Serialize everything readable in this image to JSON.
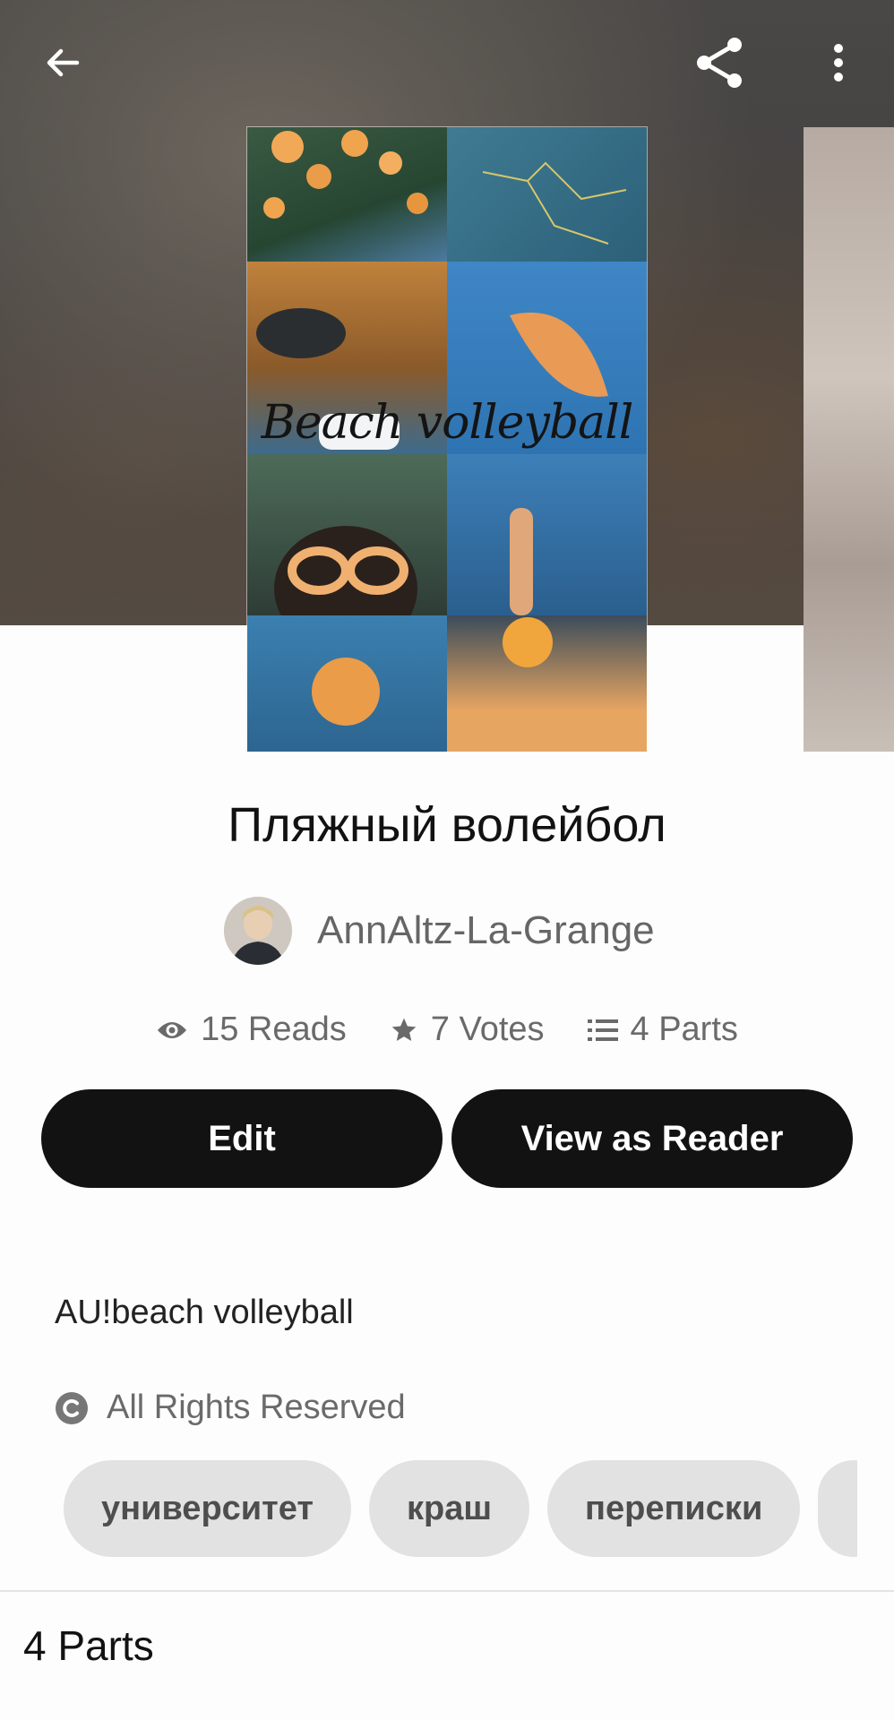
{
  "cover": {
    "overlay_text": "Beach volleyball"
  },
  "story": {
    "title": "Пляжный волейбол",
    "author": "AnnAltz-La-Grange"
  },
  "stats": {
    "reads": "15 Reads",
    "votes": "7 Votes",
    "parts": "4 Parts"
  },
  "actions": {
    "edit_label": "Edit",
    "view_as_reader_label": "View as Reader"
  },
  "description": "AU!beach volleyball",
  "copyright": "All Rights Reserved",
  "tags": [
    "университет",
    "краш",
    "переписки"
  ],
  "parts_section": {
    "heading": "4 Parts"
  },
  "icons": {
    "back": "back-arrow-icon",
    "share": "share-icon",
    "more": "more-vertical-icon",
    "reads": "eye-icon",
    "votes": "star-icon",
    "parts": "list-icon",
    "copyright": "copyright-icon"
  }
}
